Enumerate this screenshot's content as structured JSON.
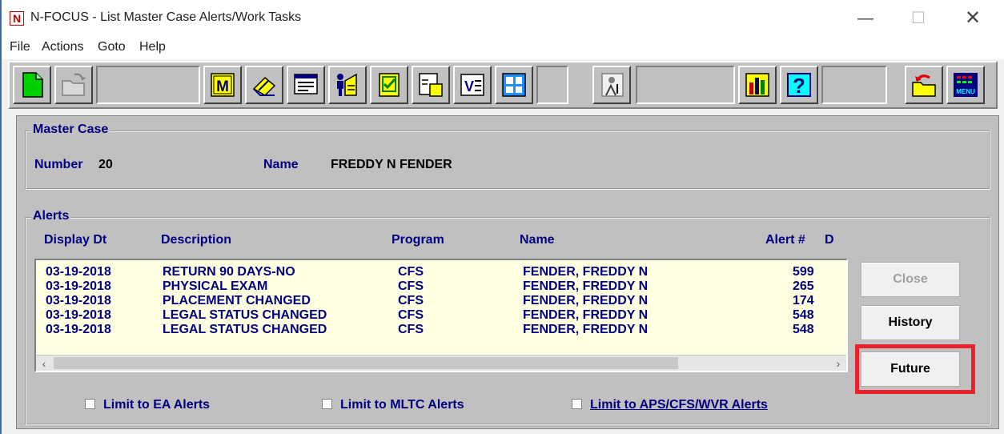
{
  "window": {
    "title": "N-FOCUS - List Master Case Alerts/Work Tasks",
    "app_icon_letter": "N",
    "minimize_glyph": "—",
    "maximize_glyph": "☐",
    "close_glyph": "✕"
  },
  "menu": [
    "File",
    "Actions",
    "Goto",
    "Help"
  ],
  "toolbar": {
    "icons": [
      "new-document-icon",
      "open-folder-icon",
      "master-case-icon",
      "eraser-icon",
      "screen-list-icon",
      "person-worksheet-icon",
      "checklist-icon",
      "neo-icon",
      "verify-icon",
      "grid-window-icon",
      "person-form-icon",
      "bar-chart-icon",
      "help-icon",
      "open-recent-folder-icon",
      "menu-icon"
    ],
    "help_glyph": "?",
    "menu_label": "MENU",
    "m_label": "M",
    "v_label": "V"
  },
  "master_case": {
    "group_title": "Master Case",
    "number_label": "Number",
    "number_value": "20",
    "name_label": "Name",
    "name_value": "FREDDY N FENDER"
  },
  "alerts": {
    "group_title": "Alerts",
    "columns": [
      "Display Dt",
      "Description",
      "Program",
      "Name",
      "Alert #",
      "D"
    ],
    "rows": [
      {
        "date": "03-19-2018",
        "description": "RETURN 90 DAYS-NO",
        "program": "CFS",
        "name": "FENDER, FREDDY N",
        "alert": "599"
      },
      {
        "date": "03-19-2018",
        "description": "PHYSICAL EXAM",
        "program": "CFS",
        "name": "FENDER, FREDDY N",
        "alert": "265"
      },
      {
        "date": "03-19-2018",
        "description": "PLACEMENT CHANGED",
        "program": "CFS",
        "name": "FENDER, FREDDY N",
        "alert": "174"
      },
      {
        "date": "03-19-2018",
        "description": "LEGAL STATUS CHANGED",
        "program": "CFS",
        "name": "FENDER, FREDDY N",
        "alert": "548"
      },
      {
        "date": "03-19-2018",
        "description": "LEGAL STATUS CHANGED",
        "program": "CFS",
        "name": "FENDER, FREDDY N",
        "alert": "548"
      }
    ],
    "scroll_left": "‹",
    "scroll_right": "›"
  },
  "buttons": {
    "close": "Close",
    "history": "History",
    "future": "Future"
  },
  "filters": {
    "ea": "Limit to EA Alerts",
    "mltc": "Limit to MLTC Alerts",
    "aps_cfs_wvr": "Limit to APS/CFS/WVR Alerts"
  },
  "colors": {
    "label_navy": "#000080",
    "list_background": "#ffffe1",
    "highlight_red": "#e8222a",
    "panel_gray": "#c0c0c0"
  }
}
